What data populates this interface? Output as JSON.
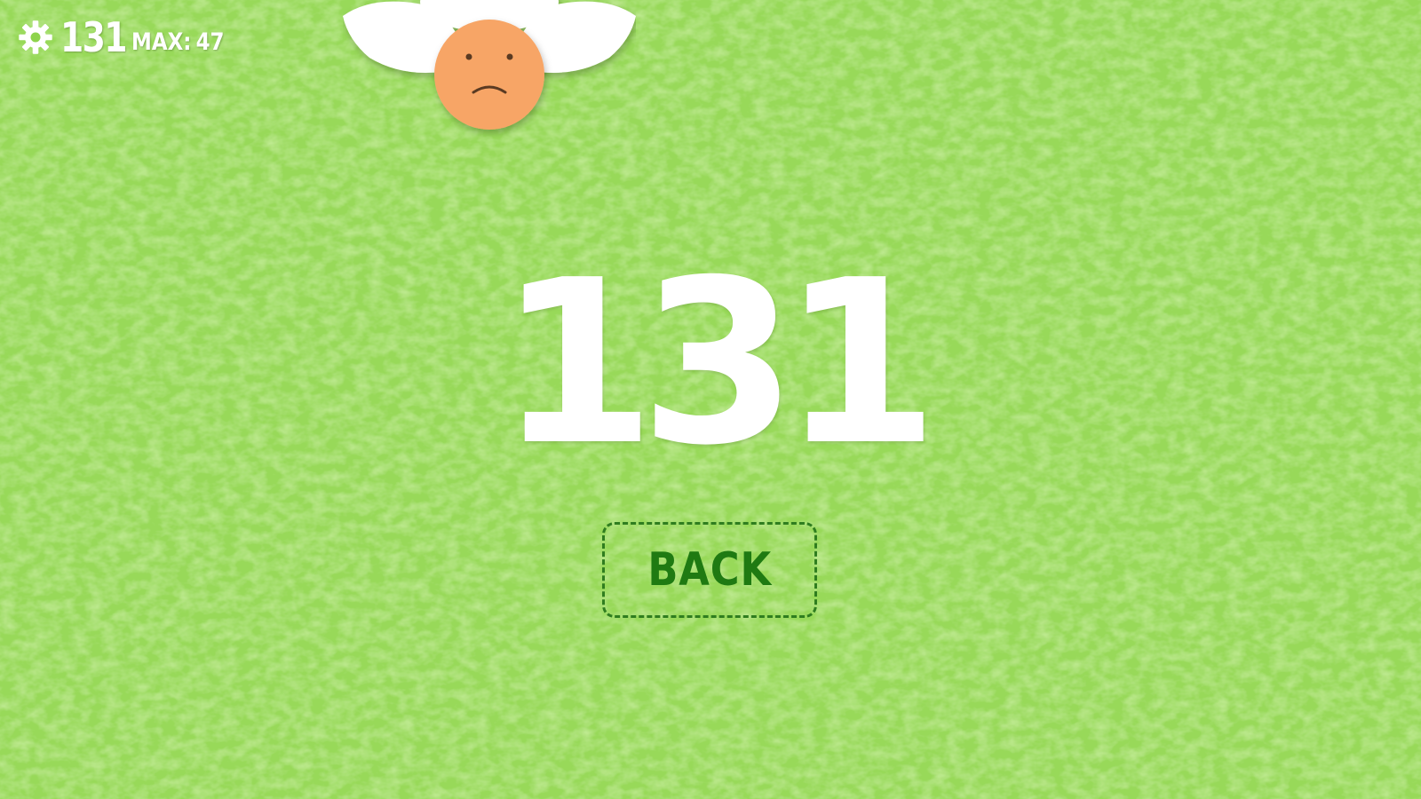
{
  "colors": {
    "background": "#8ed34c",
    "text": "#ffffff",
    "button_text": "#1f7a12",
    "button_border": "#2f7d1f",
    "face": "#f7a566",
    "wings": "#ffffff"
  },
  "hud": {
    "icon": "gear-icon",
    "score": "131",
    "max_label": "MAX:",
    "max_value": "47"
  },
  "character": {
    "icon": "sad-angel-face-icon",
    "expression": "sad"
  },
  "result": {
    "score": "131"
  },
  "back_button": {
    "label": "BACK"
  }
}
